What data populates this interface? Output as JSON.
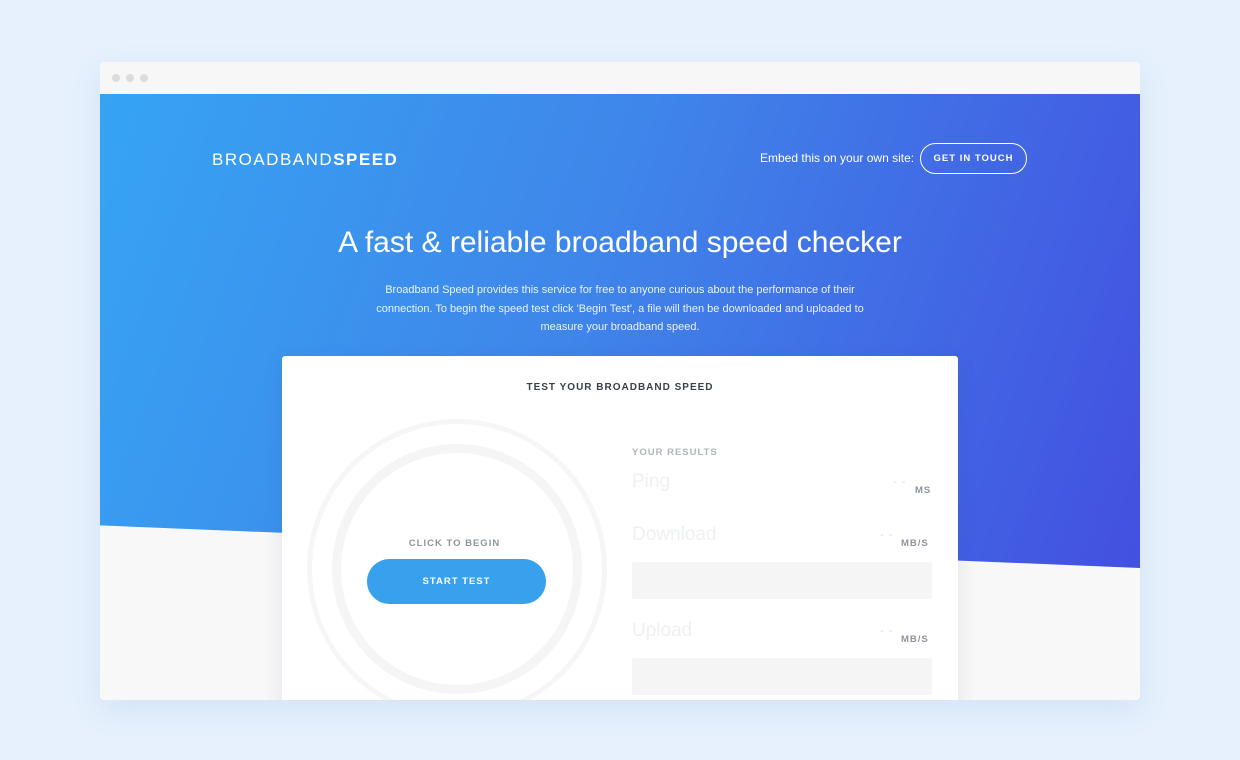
{
  "header": {
    "logo_light": "BROADBAND",
    "logo_bold": "SPEED",
    "embed_text": "Embed this on your own site:",
    "cta_label": "GET IN TOUCH"
  },
  "hero": {
    "headline": "A fast & reliable broadband speed checker",
    "intro": "Broadband Speed provides this service for free to anyone curious about the performance of their connection.  To begin the speed test click 'Begin Test',  a file will then be downloaded and uploaded to measure your broadband speed."
  },
  "card": {
    "title": "TEST YOUR BROADBAND SPEED",
    "click_label": "CLICK TO BEGIN",
    "start_label": "START TEST",
    "results_label": "YOUR RESULTS",
    "metrics": [
      {
        "name": "Ping",
        "value": "- -",
        "unit": "MS"
      },
      {
        "name": "Download",
        "value": "- -",
        "unit": "MB/S"
      },
      {
        "name": "Upload",
        "value": "- -",
        "unit": "MB/S"
      }
    ]
  },
  "colors": {
    "gradient_start": "#36a4f2",
    "gradient_end": "#4350e0",
    "button": "#38a1ee"
  }
}
